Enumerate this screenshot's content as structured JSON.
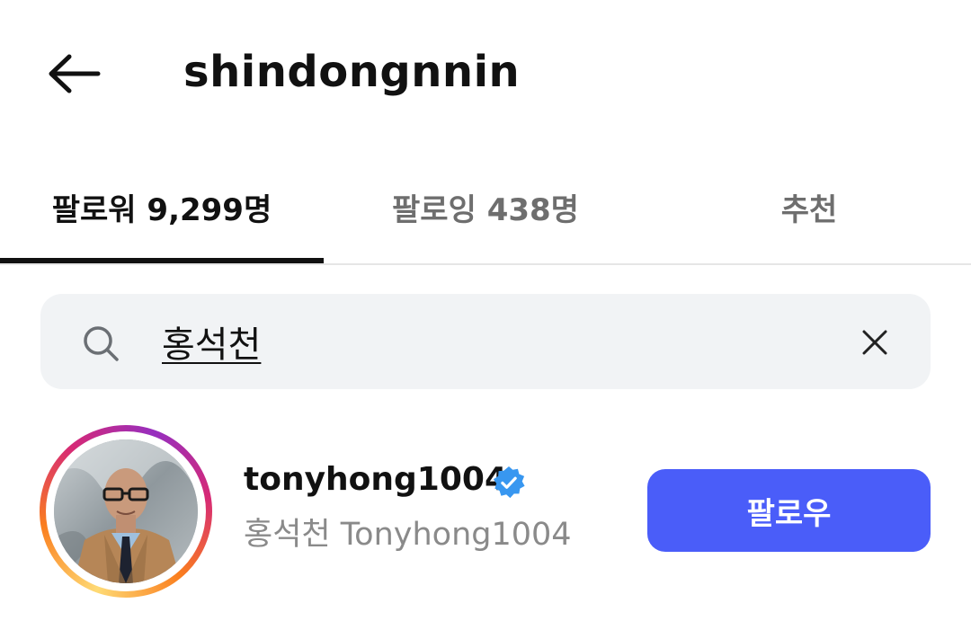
{
  "header": {
    "title": "shindongnnin",
    "back_icon": "arrow-left-icon"
  },
  "tabs": [
    {
      "label": "팔로워 9,299명",
      "active": true
    },
    {
      "label": "팔로잉 438명",
      "active": false
    },
    {
      "label": "추천",
      "active": false
    }
  ],
  "search": {
    "value": "홍석천",
    "icon": "search-icon",
    "clear_icon": "close-icon"
  },
  "results": [
    {
      "username": "tonyhong1004",
      "verified": true,
      "full_name": "홍석천 Tonyhong1004",
      "follow_label": "팔로우"
    }
  ],
  "colors": {
    "follow_button": "#4a5df9",
    "verified_badge": "#3897f0",
    "active_tab_text": "#111111",
    "inactive_tab_text": "#6e6e6e",
    "search_bg": "#f1f3f5"
  }
}
